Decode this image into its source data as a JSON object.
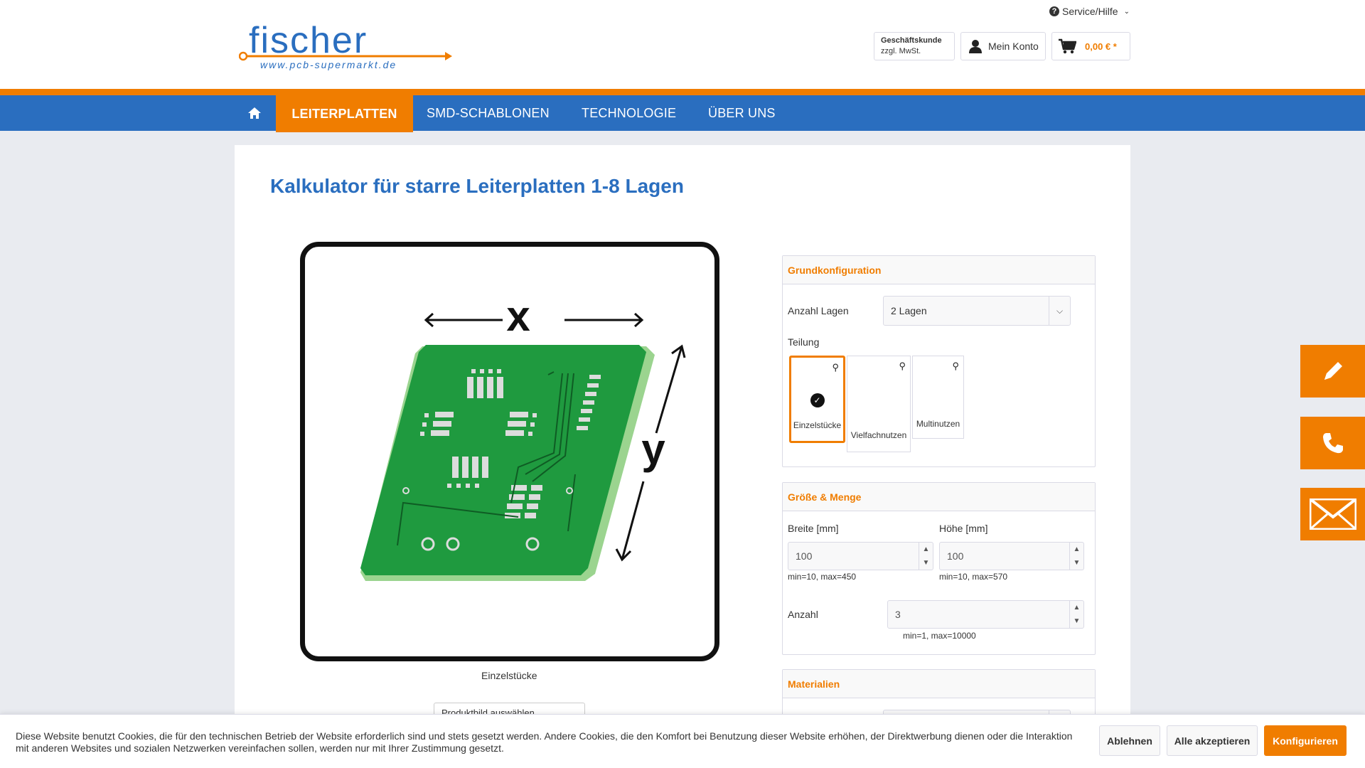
{
  "header": {
    "service_label": "Service/Hilfe",
    "customer_type_title": "Geschäftskunde",
    "customer_type_sub": "zzgl. MwSt.",
    "account_label": "Mein Konto",
    "cart_amount": "0,00 € *",
    "logo_text": "fischer",
    "logo_url": "www.pcb-supermarkt.de"
  },
  "nav": {
    "home_icon": "home-icon",
    "items": [
      "Leiterplatten",
      "SMD-Schablonen",
      "Technologie",
      "Über uns"
    ]
  },
  "page": {
    "title": "Kalkulator für starre Leiterplatten 1-8 Lagen",
    "image_caption": "Einzelstücke",
    "image_select": "Produktbild auswählen"
  },
  "grundkonfiguration": {
    "heading": "Grundkonfiguration",
    "layers_label": "Anzahl Lagen",
    "layers_value": "2 Lagen",
    "teilung_label": "Teilung",
    "teilung_options": [
      "Einzelstücke",
      "Vielfachnutzen",
      "Multinutzen"
    ],
    "teilung_selected": "Einzelstücke"
  },
  "groesse_menge": {
    "heading": "Größe & Menge",
    "width_label": "Breite [mm]",
    "width_value": "100",
    "width_hint": "min=10, max=450",
    "height_label": "Höhe [mm]",
    "height_value": "100",
    "height_hint": "min=10, max=570",
    "qty_label": "Anzahl",
    "qty_value": "3",
    "qty_hint": "min=1, max=10000"
  },
  "materialien": {
    "heading": "Materialien"
  },
  "side_buttons": [
    "pencil-icon",
    "phone-icon",
    "mail-icon"
  ],
  "cookie": {
    "text": "Diese Website benutzt Cookies, die für den technischen Betrieb der Website erforderlich sind und stets gesetzt werden. Andere Cookies, die den Komfort bei Benutzung dieser Website erhöhen, der Direktwerbung dienen oder die Interaktion mit anderen Websites und sozialen Netzwerken vereinfachen sollen, werden nur mit Ihrer Zustimmung gesetzt.",
    "decline": "Ablehnen",
    "accept_all": "Alle akzeptieren",
    "configure": "Konfigurieren"
  },
  "colors": {
    "brand_blue": "#2a6ebf",
    "brand_orange": "#f07d00",
    "pcb_green": "#1a8f3a"
  }
}
